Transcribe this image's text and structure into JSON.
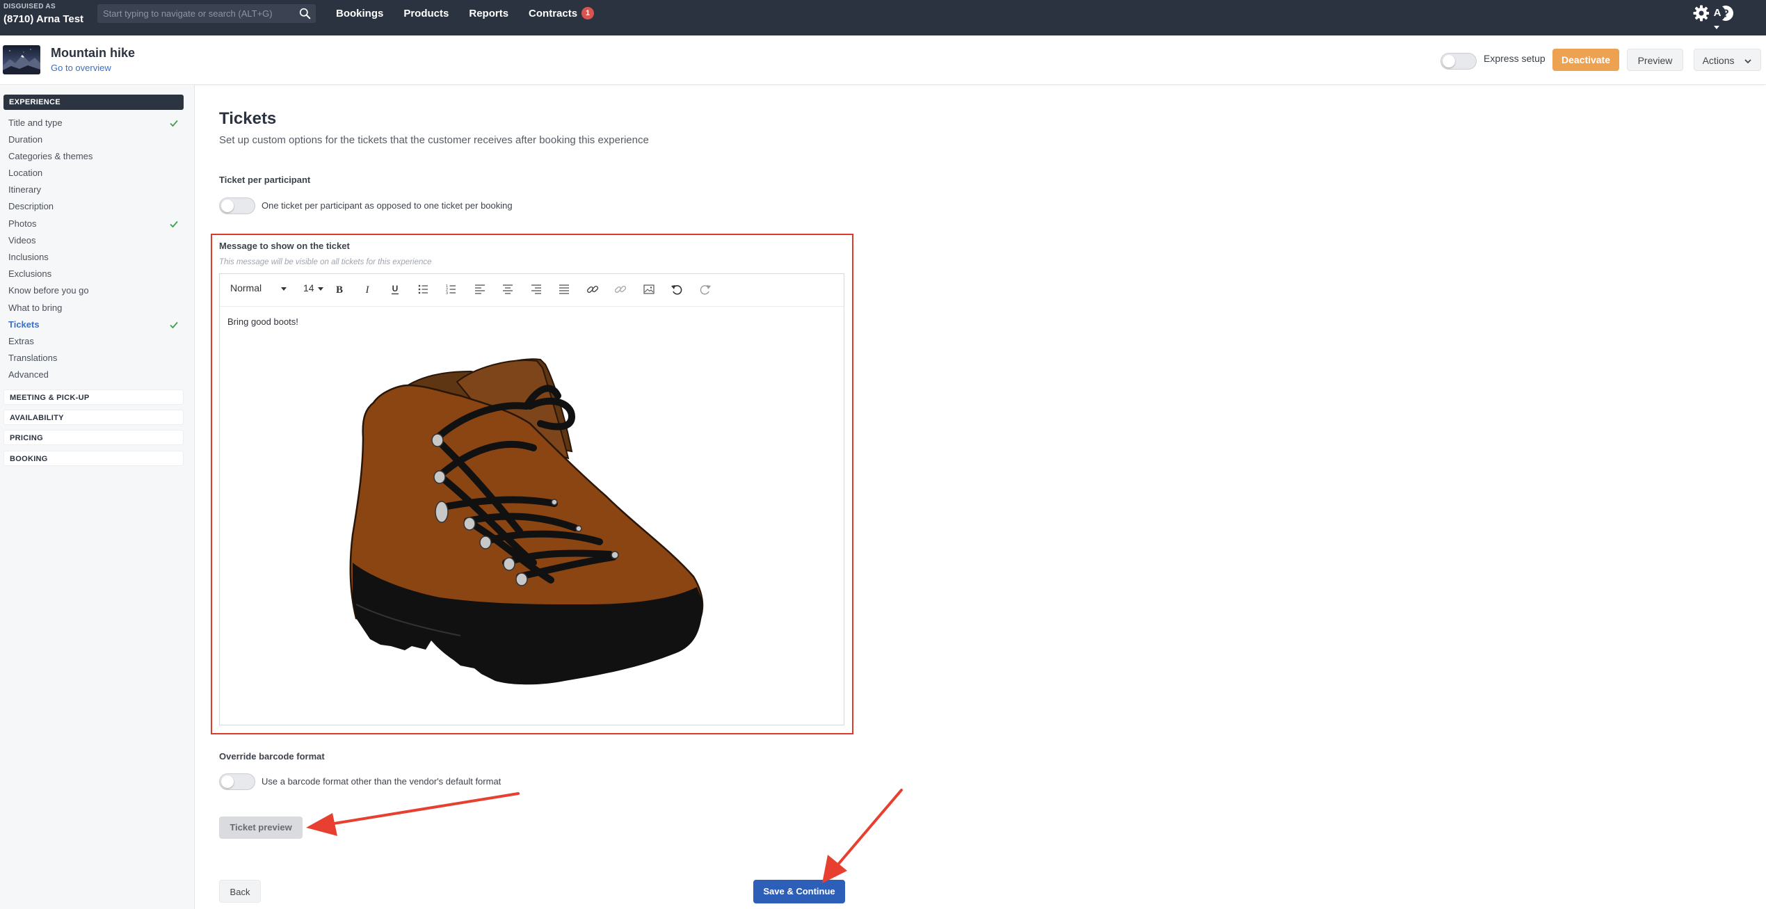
{
  "topbar": {
    "disguised_label": "DISGUISED AS",
    "account_name": "(8710) Arna Test",
    "search_placeholder": "Start typing to navigate or search (ALT+G)",
    "nav": [
      {
        "label": "Bookings"
      },
      {
        "label": "Products"
      },
      {
        "label": "Reports"
      },
      {
        "label": "Contracts",
        "badge": "1"
      }
    ],
    "icons": [
      "gear-icon",
      "help-icon"
    ],
    "avatar_initial": "A"
  },
  "header": {
    "product_title": "Mountain hike",
    "overview_link": "Go to overview",
    "express_setup_label": "Express setup",
    "express_setup_on": false,
    "deactivate_label": "Deactivate",
    "preview_label": "Preview",
    "actions_label": "Actions",
    "accent_color": "#eda252"
  },
  "sidebar": {
    "sections": [
      {
        "title": "EXPERIENCE",
        "active": true,
        "items": [
          {
            "label": "Title and type",
            "complete": true
          },
          {
            "label": "Duration",
            "complete": false
          },
          {
            "label": "Categories & themes",
            "complete": false
          },
          {
            "label": "Location",
            "complete": false
          },
          {
            "label": "Itinerary",
            "complete": false
          },
          {
            "label": "Description",
            "complete": false
          },
          {
            "label": "Photos",
            "complete": true
          },
          {
            "label": "Videos",
            "complete": false
          },
          {
            "label": "Inclusions",
            "complete": false
          },
          {
            "label": "Exclusions",
            "complete": false
          },
          {
            "label": "Know before you go",
            "complete": false
          },
          {
            "label": "What to bring",
            "complete": false
          },
          {
            "label": "Tickets",
            "complete": true,
            "active": true
          },
          {
            "label": "Extras",
            "complete": false
          },
          {
            "label": "Translations",
            "complete": false
          },
          {
            "label": "Advanced",
            "complete": false
          }
        ]
      },
      {
        "title": "MEETING & PICK-UP"
      },
      {
        "title": "AVAILABILITY"
      },
      {
        "title": "PRICING"
      },
      {
        "title": "BOOKING"
      }
    ]
  },
  "main": {
    "title": "Tickets",
    "subtitle": "Set up custom options for the tickets that the customer receives after booking this experience",
    "ticket_per_participant": {
      "label": "Ticket per participant",
      "toggle_text": "One ticket per participant as opposed to one ticket per booking",
      "on": false
    },
    "message": {
      "label": "Message to show on the ticket",
      "hint": "This message will be visible on all tickets for this experience",
      "toolbar": {
        "format_value": "Normal",
        "size_value": "14",
        "buttons": [
          "bold-icon",
          "italic-icon",
          "underline-icon",
          "bullet-list-icon",
          "ordered-list-icon",
          "align-left-icon",
          "align-center-icon",
          "align-right-icon",
          "align-justify-icon",
          "link-icon",
          "unlink-icon",
          "image-icon",
          "undo-icon",
          "redo-icon"
        ]
      },
      "content_text": "Bring good boots!",
      "content_image": "hiking-boot-image"
    },
    "override_barcode": {
      "label": "Override barcode format",
      "toggle_text": "Use a barcode format other than the vendor's default format",
      "on": false
    },
    "ticket_preview_label": "Ticket preview",
    "back_label": "Back",
    "save_label": "Save & Continue",
    "primary_color": "#2e5fb8",
    "annotation_color": "#dc3b2c"
  }
}
